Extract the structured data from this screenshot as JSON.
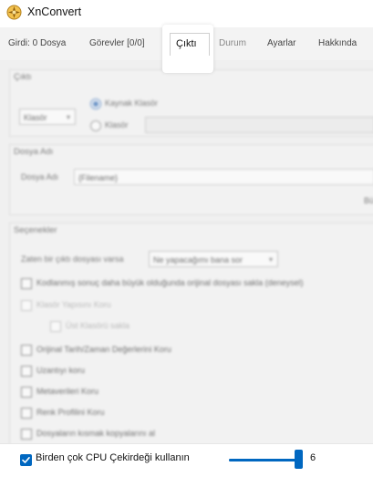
{
  "window": {
    "title": "XnConvert"
  },
  "tabs": [
    {
      "label": "Girdi: 0 Dosya"
    },
    {
      "label": "Görevler [0/0]"
    },
    {
      "label": "Çıktı"
    },
    {
      "label": "Durum"
    },
    {
      "label": "Ayarlar"
    },
    {
      "label": "Hakkında"
    }
  ],
  "active_tab": "Çıktı",
  "output_group": {
    "title": "Çıktı",
    "folder_combo": "Klasör",
    "radio_source": "Kaynak Klasör",
    "radio_folder": "Klasör"
  },
  "filename_group": {
    "title": "Dosya Adı",
    "label": "Dosya Adı",
    "value": "{Filename}",
    "overflow_text": "Bü"
  },
  "options_group": {
    "title": "Seçenekler",
    "exists_label": "Zaten bir çıktı dosyası varsa",
    "exists_value": "Ne yapacağımı bana sor",
    "checkboxes": [
      {
        "label": "Kodlanmış sonuç daha büyük olduğunda orijinal dosyası sakla (deneysel)",
        "disabled": false
      },
      {
        "label": "Klasör Yapısını Koru",
        "disabled": true
      },
      {
        "label": "Üst Klasörü sakla",
        "disabled": true
      },
      {
        "label": "Orijinal Tarih/Zaman Değerlerini Koru",
        "disabled": false
      },
      {
        "label": "Uzantıyı koru",
        "disabled": false
      },
      {
        "label": "Metaverileri Koru",
        "disabled": false
      },
      {
        "label": "Renk Profilini Koru",
        "disabled": false
      },
      {
        "label": "Dosyaların kısmak kopyalarını al",
        "disabled": false
      }
    ]
  },
  "cpu": {
    "label": "Birden çok CPU Çekirdeği kullanın",
    "checked": true,
    "value": "6",
    "level": 0.95
  },
  "colors": {
    "accent": "#0067c0"
  },
  "icons": {
    "app": "xnconvert-logo-icon",
    "check": "checkmark-icon"
  }
}
